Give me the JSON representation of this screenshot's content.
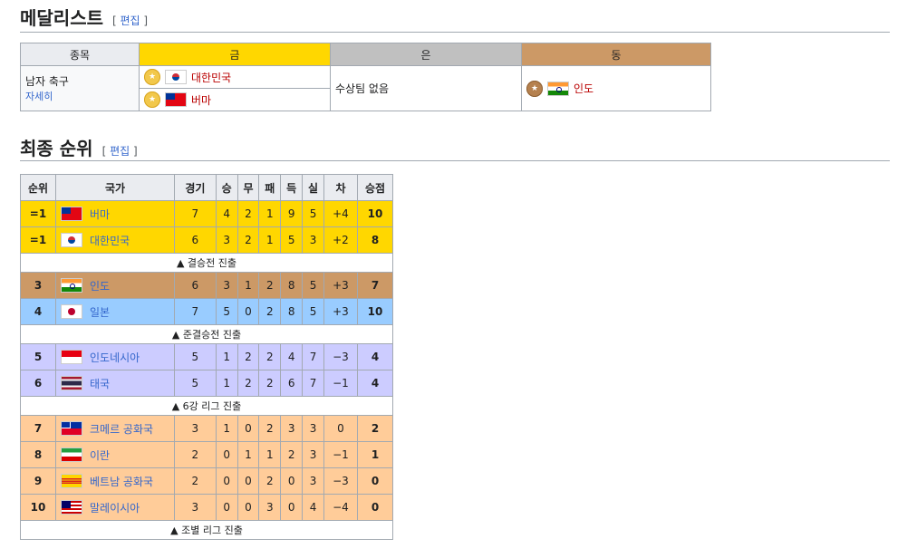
{
  "medalists": {
    "heading": "메달리스트",
    "edit_label": "편집",
    "columns": {
      "event": "종목",
      "gold": "금",
      "silver": "은",
      "bronze": "동"
    },
    "event_name": "남자 축구",
    "event_link": "자세히",
    "gold": [
      "대한민국",
      "버마"
    ],
    "silver_note": "수상팀 없음",
    "bronze": "인도"
  },
  "standings": {
    "heading": "최종 순위",
    "edit_label": "편집",
    "columns": [
      "순위",
      "국가",
      "경기",
      "승",
      "무",
      "패",
      "득",
      "실",
      "차",
      "승점"
    ],
    "rows": [
      {
        "pos": "=1",
        "team": "버마",
        "p": "7",
        "w": "4",
        "d": "2",
        "l": "1",
        "gf": "9",
        "ga": "5",
        "gd": "+4",
        "pts": "10",
        "flag": "burma"
      },
      {
        "pos": "=1",
        "team": "대한민국",
        "p": "6",
        "w": "3",
        "d": "2",
        "l": "1",
        "gf": "5",
        "ga": "3",
        "gd": "+2",
        "pts": "8",
        "flag": "korea"
      },
      {
        "pos": "3",
        "team": "인도",
        "p": "6",
        "w": "3",
        "d": "1",
        "l": "2",
        "gf": "8",
        "ga": "5",
        "gd": "+3",
        "pts": "7",
        "flag": "india"
      },
      {
        "pos": "4",
        "team": "일본",
        "p": "7",
        "w": "5",
        "d": "0",
        "l": "2",
        "gf": "8",
        "ga": "5",
        "gd": "+3",
        "pts": "10",
        "flag": "japan"
      },
      {
        "pos": "5",
        "team": "인도네시아",
        "p": "5",
        "w": "1",
        "d": "2",
        "l": "2",
        "gf": "4",
        "ga": "7",
        "gd": "−3",
        "pts": "4",
        "flag": "indonesia"
      },
      {
        "pos": "6",
        "team": "태국",
        "p": "5",
        "w": "1",
        "d": "2",
        "l": "2",
        "gf": "6",
        "ga": "7",
        "gd": "−1",
        "pts": "4",
        "flag": "thailand"
      },
      {
        "pos": "7",
        "team": "크메르 공화국",
        "p": "3",
        "w": "1",
        "d": "0",
        "l": "2",
        "gf": "3",
        "ga": "3",
        "gd": "0",
        "pts": "2",
        "flag": "khmer"
      },
      {
        "pos": "8",
        "team": "이란",
        "p": "2",
        "w": "0",
        "d": "1",
        "l": "1",
        "gf": "2",
        "ga": "3",
        "gd": "−1",
        "pts": "1",
        "flag": "iran"
      },
      {
        "pos": "9",
        "team": "베트남 공화국",
        "p": "2",
        "w": "0",
        "d": "0",
        "l": "2",
        "gf": "0",
        "ga": "3",
        "gd": "−3",
        "pts": "0",
        "flag": "svietnam"
      },
      {
        "pos": "10",
        "team": "말레이시아",
        "p": "3",
        "w": "0",
        "d": "0",
        "l": "3",
        "gf": "0",
        "ga": "4",
        "gd": "−4",
        "pts": "0",
        "flag": "malaysia"
      }
    ],
    "notes": [
      "▲ 결승전 진출",
      "▲ 준결승전 진출",
      "▲ 6강 리그 진출",
      "▲ 조별 리그 진출"
    ]
  },
  "colors": {
    "gold": "#ffd700",
    "silver": "#c0c0c0",
    "bronze": "#cc9966",
    "light_blue": "#99ccff",
    "lavender": "#ccccff",
    "peach": "#ffcc99",
    "header_gray": "#eaecf0",
    "link_blue": "#3366cc"
  },
  "icons": {
    "medal": "medal-icon",
    "flag": "flag-icon"
  }
}
